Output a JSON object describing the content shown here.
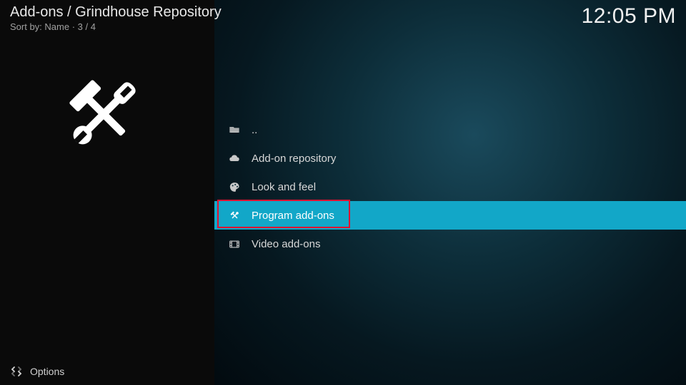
{
  "header": {
    "breadcrumb": "Add-ons / Grindhouse Repository",
    "sort_label": "Sort by: Name  ·  3 / 4",
    "clock": "12:05 PM"
  },
  "list": {
    "items": [
      {
        "icon": "folder-up",
        "label": ".."
      },
      {
        "icon": "cloud",
        "label": "Add-on repository"
      },
      {
        "icon": "paint",
        "label": "Look and feel"
      },
      {
        "icon": "tools",
        "label": "Program add-ons",
        "selected": true,
        "highlighted": true
      },
      {
        "icon": "film",
        "label": "Video add-ons"
      }
    ]
  },
  "footer": {
    "options_label": "Options"
  }
}
